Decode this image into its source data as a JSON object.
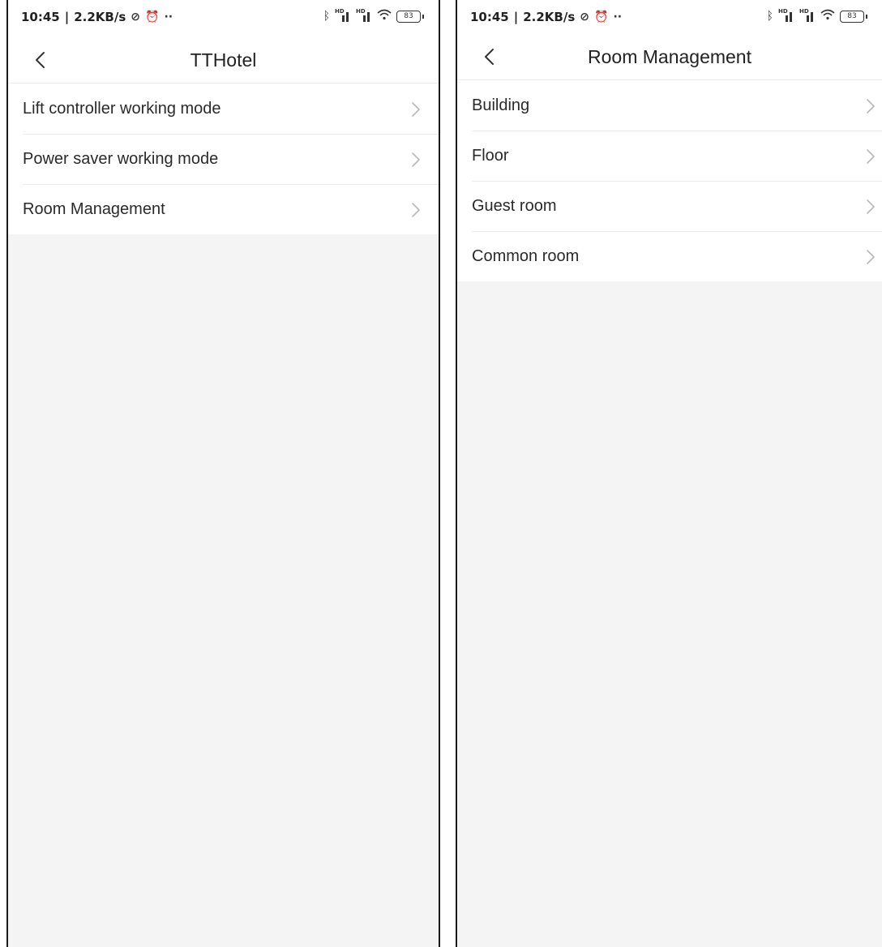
{
  "status_bar": {
    "time": "10:45",
    "speed": "2.2KB/s",
    "battery": "83",
    "network_label": "HD"
  },
  "screens": [
    {
      "title": "TTHotel",
      "items": [
        {
          "label": "Lift controller working mode"
        },
        {
          "label": "Power saver working mode"
        },
        {
          "label": "Room Management"
        }
      ]
    },
    {
      "title": "Room Management",
      "items": [
        {
          "label": "Building"
        },
        {
          "label": "Floor"
        },
        {
          "label": "Guest room"
        },
        {
          "label": "Common room"
        }
      ]
    }
  ],
  "icons": {
    "back": "chevron-left-icon",
    "row_arrow": "chevron-right-icon",
    "status": [
      "mute-icon",
      "alarm-icon",
      "bluetooth-icon",
      "signal-icon",
      "wifi-icon",
      "battery-icon"
    ]
  },
  "colors": {
    "background": "#f4f4f4",
    "surface": "#ffffff",
    "text": "#2a2a2a",
    "divider": "#ececec",
    "chevron": "#b8b8b8"
  }
}
